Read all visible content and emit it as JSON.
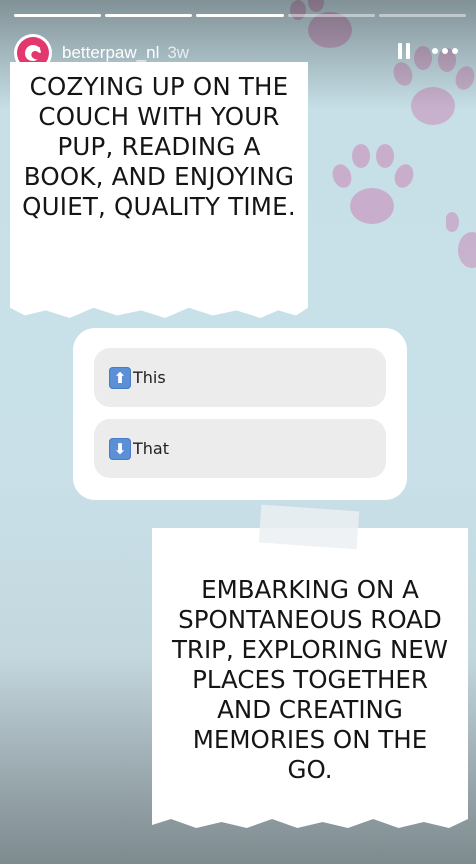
{
  "story": {
    "progress_segments": [
      {
        "state": "done"
      },
      {
        "state": "done"
      },
      {
        "state": "done"
      },
      {
        "state": "pending"
      },
      {
        "state": "pending"
      }
    ]
  },
  "header": {
    "username": "betterpaw_nl",
    "age": "3w",
    "avatar_icon": "betterpaw-logo-icon",
    "pause_icon": "pause-icon",
    "more_icon": "more-options-icon"
  },
  "notes": {
    "top_text": "COZYING UP ON THE COUCH WITH YOUR PUP, READING A BOOK, AND ENJOYING QUIET, QUALITY TIME.",
    "bottom_text": "EMBARKING ON A SPONTANEOUS ROAD TRIP, EXPLORING NEW PLACES TOGETHER AND CREATING MEMORIES ON THE GO."
  },
  "poll": {
    "options": [
      {
        "icon": "up-arrow-icon",
        "glyph": "⬆",
        "label": "This"
      },
      {
        "icon": "down-arrow-icon",
        "glyph": "⬇",
        "label": "That"
      }
    ]
  },
  "colors": {
    "brand": "#e2386d",
    "background": "#c6dfe7",
    "paw": "#c9a9c9"
  }
}
